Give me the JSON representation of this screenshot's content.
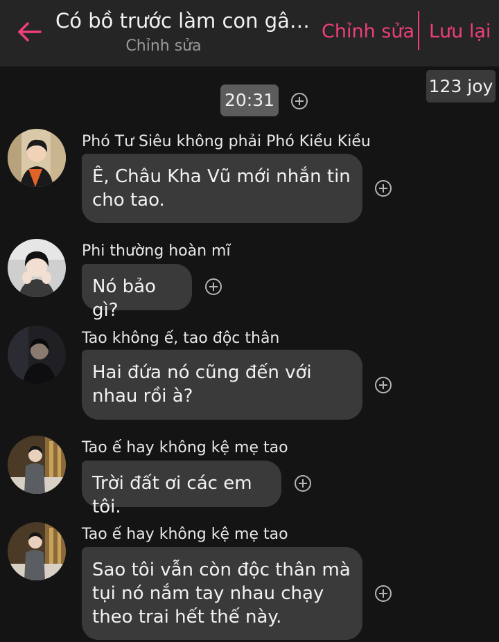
{
  "header": {
    "title": "Có bồ trước làm con gâu ...",
    "subtitle": "Chỉnh sửa",
    "edit_label": "Chỉnh sửa",
    "save_label": "Lưu lại",
    "back_icon": "arrow-left-icon",
    "accent_color": "#ee3f78"
  },
  "timestamp": "20:31",
  "coin_badge": "123 joy",
  "messages": [
    {
      "sender": "Phó Tư Siêu không phải Phó Kiều Kiều",
      "text": "Ê, Châu Kha Vũ mới nhắn tin cho tao."
    },
    {
      "sender": "Phi thường hoàn mĩ",
      "text": "Nó bảo gì?"
    },
    {
      "sender": "Tao không ế, tao độc thân",
      "text": "Hai đứa nó cũng đến với nhau rồi à?"
    },
    {
      "sender": "Tao ế hay không kệ mẹ tao",
      "text": "Trời đất ơi các em tôi."
    },
    {
      "sender": "Tao ế hay không kệ mẹ tao",
      "text": "Sao tôi vẫn còn độc thân mà tụi nó nắm tay nhau chạy theo trai hết thế này."
    }
  ],
  "colors": {
    "background": "#141414",
    "header_bg": "#252525",
    "bubble_bg": "#3a3a3a",
    "time_chip_bg": "#5c5c5c"
  }
}
